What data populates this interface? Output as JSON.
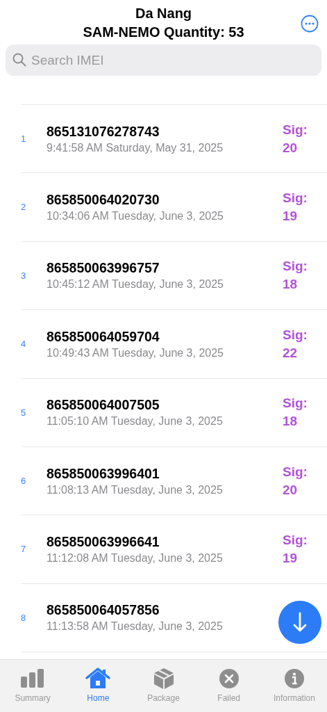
{
  "header": {
    "title": "Da Nang",
    "subtitle": "SAM-NEMO Quantity: 53"
  },
  "search": {
    "placeholder": "Search IMEI"
  },
  "rows": [
    {
      "index": "1",
      "imei": "865131076278743",
      "time": "9:41:58 AM Saturday, May 31, 2025",
      "signal_label": "Sig:",
      "signal": "20"
    },
    {
      "index": "2",
      "imei": "865850064020730",
      "time": "10:34:06 AM Tuesday, June 3, 2025",
      "signal_label": "Sig:",
      "signal": "19"
    },
    {
      "index": "3",
      "imei": "865850063996757",
      "time": "10:45:12 AM Tuesday, June 3, 2025",
      "signal_label": "Sig:",
      "signal": "18"
    },
    {
      "index": "4",
      "imei": "865850064059704",
      "time": "10:49:43 AM Tuesday, June 3, 2025",
      "signal_label": "Sig:",
      "signal": "22"
    },
    {
      "index": "5",
      "imei": "865850064007505",
      "time": "11:05:10 AM Tuesday, June 3, 2025",
      "signal_label": "Sig:",
      "signal": "18"
    },
    {
      "index": "6",
      "imei": "865850063996401",
      "time": "11:08:13 AM Tuesday, June 3, 2025",
      "signal_label": "Sig:",
      "signal": "20"
    },
    {
      "index": "7",
      "imei": "865850063996641",
      "time": "11:12:08 AM Tuesday, June 3, 2025",
      "signal_label": "Sig:",
      "signal": "19"
    },
    {
      "index": "8",
      "imei": "865850064057856",
      "time": "11:13:58 AM Tuesday, June 3, 2025"
    }
  ],
  "tabs": [
    {
      "kind": "summary",
      "label": "Summary",
      "selected": false
    },
    {
      "kind": "home",
      "label": "Home",
      "selected": true
    },
    {
      "kind": "package",
      "label": "Package",
      "selected": false
    },
    {
      "kind": "failed",
      "label": "Failed",
      "selected": false
    },
    {
      "kind": "information",
      "label": "Information",
      "selected": false
    }
  ]
}
